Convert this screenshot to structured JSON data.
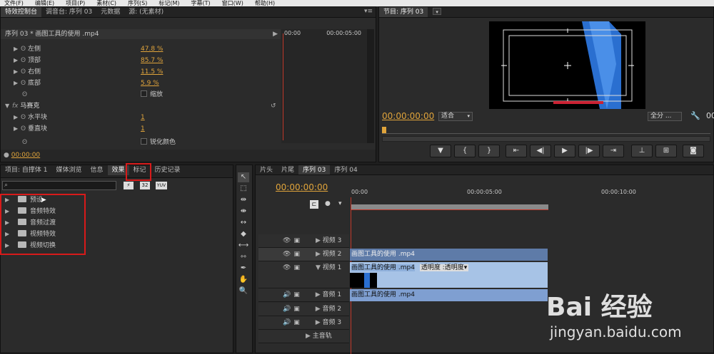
{
  "menu": [
    "文件(F)",
    "编辑(E)",
    "项目(P)",
    "素材(C)",
    "序列(S)",
    "标记(M)",
    "字幕(T)",
    "窗口(W)",
    "帮助(H)"
  ],
  "effect_controls": {
    "tabs": [
      "特效控制台",
      "调音台: 序列 03",
      "元数据",
      "源: (无素材)"
    ],
    "header": "序列 03 * 画图工具的使用 .mp4",
    "ruler_start": "00:00",
    "ruler_end": "00:00:05:00",
    "props": [
      {
        "name": "左侧",
        "value": "47.8 %"
      },
      {
        "name": "顶部",
        "value": "85.7 %"
      },
      {
        "name": "右侧",
        "value": "11.5 %"
      },
      {
        "name": "底部",
        "value": "5.9 %"
      }
    ],
    "scale_label": "缩放",
    "fx_name": "马赛克",
    "fx_props": [
      {
        "name": "水平块",
        "value": "1"
      },
      {
        "name": "垂直块",
        "value": "1"
      }
    ],
    "sharpen_label": "锐化颜色",
    "timecode": "00:00:00"
  },
  "program_monitor": {
    "tab": "节目: 序列 03",
    "timecode": "00:00:00:00",
    "fit": "适合",
    "quality": "全分 ...",
    "right_num": "00"
  },
  "project": {
    "tabs": [
      "项目: 自撑体 1",
      "媒体浏览",
      "信息",
      "效果",
      "标记",
      "历史记录"
    ],
    "search_placeholder": "",
    "search_btns": [
      "32",
      "YUV"
    ],
    "folders": [
      "预设",
      "音频特效",
      "音频过渡",
      "视频特效",
      "视频切换"
    ]
  },
  "timeline": {
    "tabs": [
      "片头",
      "片尾",
      "序列 03",
      "序列 04"
    ],
    "timecode": "00:00:00:00",
    "ruler": [
      "00:00",
      "00:00:05:00",
      "00:00:10:00"
    ],
    "tracks": [
      {
        "name": "视频 3",
        "type": "video"
      },
      {
        "name": "视频 2",
        "type": "video"
      },
      {
        "name": "视频 1",
        "type": "video"
      },
      {
        "name": "音频 1",
        "type": "audio"
      },
      {
        "name": "音频 2",
        "type": "audio"
      },
      {
        "name": "音频 3",
        "type": "audio"
      },
      {
        "name": "主音轨",
        "type": "master"
      }
    ],
    "clip_v2": "画图工具的使用 .mp4",
    "clip_v1": "画图工具的使用 .mp4",
    "clip_v1_fx": "透明度 :透明度",
    "clip_a1": "画图工具的使用 .mp4"
  },
  "watermark": {
    "brand": "Bai 经验",
    "url": "jingyan.baidu.com"
  }
}
